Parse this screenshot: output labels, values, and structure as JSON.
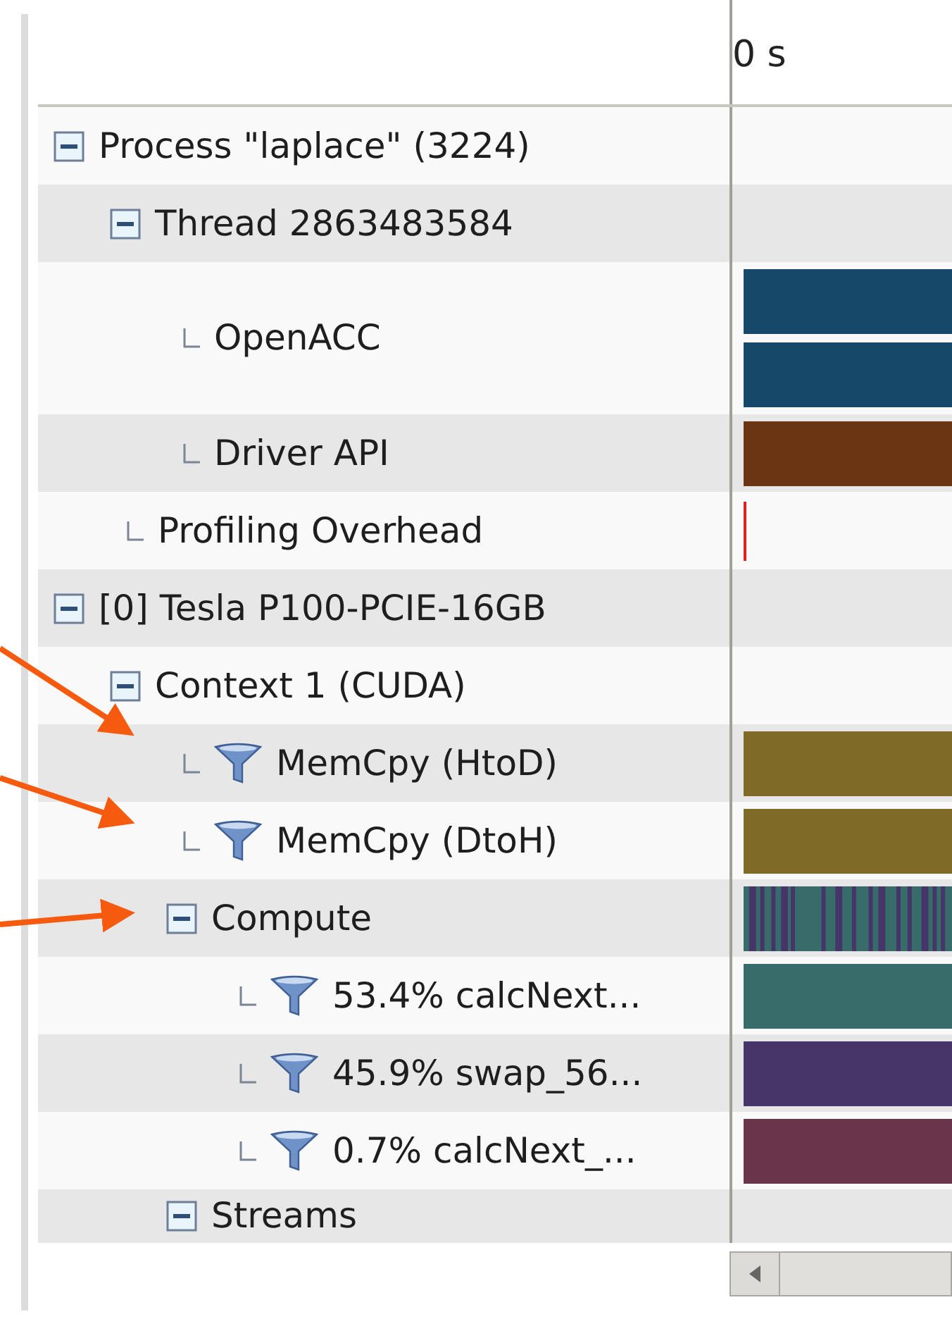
{
  "timeline": {
    "ruler_label": "0 s"
  },
  "tree": [
    {
      "label": "Process \"laplace\" (3224)",
      "kind": "group",
      "expanded": true,
      "children": [
        {
          "label": "Thread 2863483584",
          "kind": "group",
          "expanded": true,
          "children": [
            {
              "label": "OpenACC",
              "kind": "leaf",
              "track": [
                {
                  "kind": "bar",
                  "color": "#16486a"
                },
                {
                  "kind": "bar",
                  "color": "#16486a"
                }
              ]
            },
            {
              "label": "Driver API",
              "kind": "leaf",
              "track": [
                {
                  "kind": "bar",
                  "color": "#6b3514"
                }
              ]
            }
          ]
        },
        {
          "label": "Profiling Overhead",
          "kind": "leaf",
          "track": [
            {
              "kind": "marker",
              "color": "#e02020"
            }
          ]
        }
      ]
    },
    {
      "label": "[0] Tesla P100-PCIE-16GB",
      "kind": "group",
      "expanded": true,
      "children": [
        {
          "label": "Context 1 (CUDA)",
          "kind": "group",
          "expanded": true,
          "children": [
            {
              "label": "MemCpy (HtoD)",
              "kind": "filter",
              "track": [
                {
                  "kind": "bar",
                  "color": "#7f6a28"
                }
              ]
            },
            {
              "label": "MemCpy (DtoH)",
              "kind": "filter",
              "track": [
                {
                  "kind": "bar",
                  "color": "#7f6a28"
                }
              ]
            },
            {
              "label": "Compute",
              "kind": "group",
              "expanded": true,
              "track": [
                {
                  "kind": "stripes",
                  "color": "#376c6a"
                }
              ],
              "children": [
                {
                  "label": "53.4% calcNext...",
                  "kind": "filter",
                  "track": [
                    {
                      "kind": "bar",
                      "color": "#376c6a"
                    }
                  ]
                },
                {
                  "label": "45.9% swap_56...",
                  "kind": "filter",
                  "track": [
                    {
                      "kind": "bar",
                      "color": "#463568"
                    }
                  ]
                },
                {
                  "label": "0.7% calcNext_...",
                  "kind": "filter",
                  "track": [
                    {
                      "kind": "bar",
                      "color": "#6a344a"
                    }
                  ]
                }
              ]
            },
            {
              "label": "Streams",
              "kind": "group",
              "expanded": true
            }
          ]
        }
      ]
    }
  ]
}
